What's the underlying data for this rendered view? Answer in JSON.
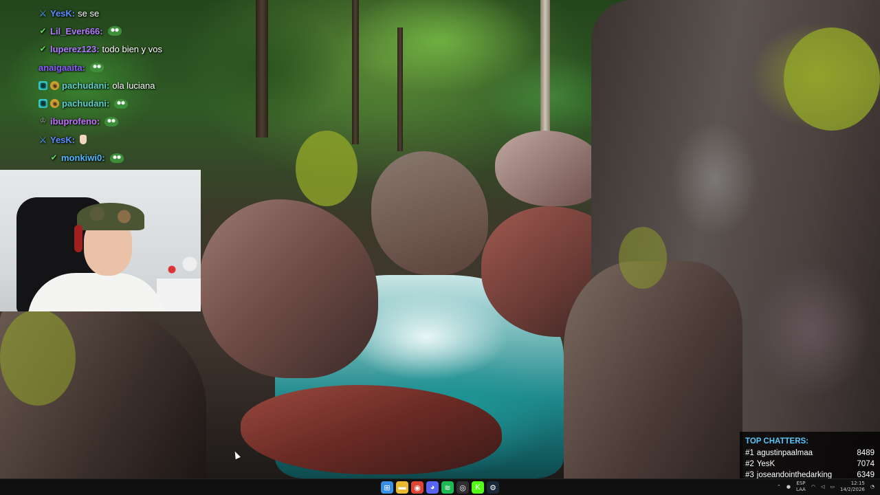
{
  "chat": [
    {
      "badges": [
        "sword"
      ],
      "user": "YesK:",
      "user_color": "#5a8cff",
      "text": "se se",
      "emote": ""
    },
    {
      "badges": [
        "mod"
      ],
      "user": "Lil_Ever666:",
      "user_color": "#b07cff",
      "text": "",
      "emote": "frog"
    },
    {
      "badges": [
        "mod"
      ],
      "user": "luperez123:",
      "user_color": "#b07cff",
      "text": "todo bien y vos",
      "emote": ""
    },
    {
      "badges": [],
      "user": "anaigaaita:",
      "user_color": "#8a5cff",
      "text": "",
      "emote": "frog"
    },
    {
      "badges": [
        "grid",
        "coin"
      ],
      "user": "pachudani:",
      "user_color": "#5fd0c8",
      "text": "ola luciana",
      "emote": ""
    },
    {
      "badges": [
        "grid",
        "coin"
      ],
      "user": "pachudani:",
      "user_color": "#5fd0c8",
      "text": "",
      "emote": "frog"
    },
    {
      "badges": [
        "crown"
      ],
      "user": "ibuprofeno:",
      "user_color": "#c070ff",
      "text": "",
      "emote": "frog"
    },
    {
      "badges": [
        "sword"
      ],
      "user": "YesK:",
      "user_color": "#5a8cff",
      "text": "",
      "emote": "hand"
    },
    {
      "badges": [
        "mod"
      ],
      "user": "monkiwi0:",
      "user_color": "#4fb8ff",
      "text": "",
      "emote": "frog",
      "indent": true
    }
  ],
  "top_chatters": {
    "title": "TOP CHATTERS:",
    "rows": [
      {
        "rank": "#1",
        "name": "agustinpaalmaa",
        "count": "8489"
      },
      {
        "rank": "#2",
        "name": "YesK",
        "count": "7074"
      },
      {
        "rank": "#3",
        "name": "joseandointhedarking",
        "count": "6349"
      }
    ]
  },
  "taskbar": {
    "apps": [
      {
        "name": "start-icon",
        "color": "#3a8ee6",
        "glyph": "⊞"
      },
      {
        "name": "file-explorer-icon",
        "color": "#e8b931",
        "glyph": "▬"
      },
      {
        "name": "chrome-icon",
        "color": "#db4437",
        "glyph": "◉"
      },
      {
        "name": "discord-icon",
        "color": "#5865f2",
        "glyph": "◕"
      },
      {
        "name": "spotify-icon",
        "color": "#1db954",
        "glyph": "≋"
      },
      {
        "name": "obs-icon",
        "color": "#302e31",
        "glyph": "◎"
      },
      {
        "name": "kick-icon",
        "color": "#53fc18",
        "glyph": "K"
      },
      {
        "name": "steam-icon",
        "color": "#1b2838",
        "glyph": "⚙"
      }
    ],
    "lang_top": "ESP",
    "lang_bottom": "LAA",
    "time": "12:15",
    "date": "14/2/2026"
  }
}
